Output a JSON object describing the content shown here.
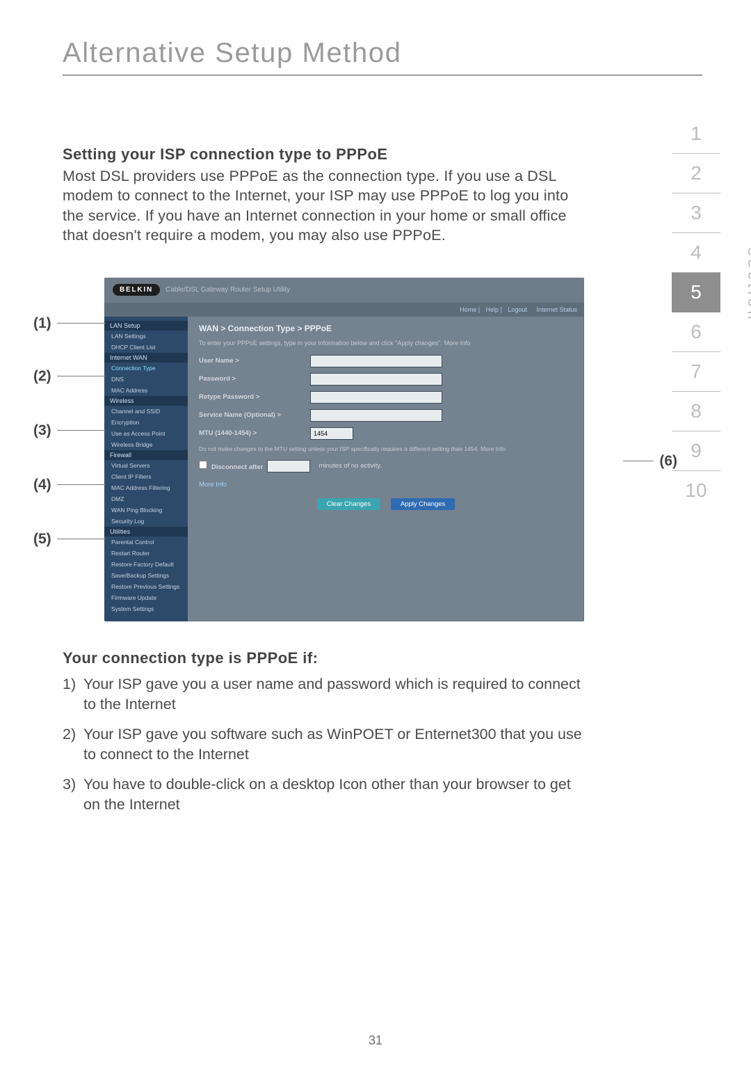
{
  "page_title": "Alternative Setup Method",
  "heading": "Setting your ISP connection type to PPPoE",
  "intro": "Most DSL providers use PPPoE as the connection type. If you use a DSL modem to connect to the Internet, your ISP may use PPPoE to log you into the service. If you have an Internet connection in your home or small office that doesn't require a modem, you may also use PPPoE.",
  "callouts": {
    "c1": "(1)",
    "c2": "(2)",
    "c3": "(3)",
    "c4": "(4)",
    "c5": "(5)",
    "c6": "(6)"
  },
  "section_nav": {
    "label": "section",
    "items": [
      "1",
      "2",
      "3",
      "4",
      "5",
      "6",
      "7",
      "8",
      "9",
      "10"
    ],
    "active": "5"
  },
  "router": {
    "brand": "BELKIN",
    "top_title": "Cable/DSL Gateway Router Setup Utility",
    "sub_links": [
      "Home",
      "Help",
      "Logout",
      "Internet Status"
    ],
    "breadcrumb": "WAN > Connection Type > PPPoE",
    "instructions": "To enter your PPPoE settings, type in your information below and click \"Apply changes\". More Info",
    "fields": {
      "user": "User Name >",
      "pass": "Password >",
      "retype": "Retype Password >",
      "service": "Service Name (Optional) >",
      "mtu": "MTU (1440-1454) >",
      "mtu_value": "1454",
      "mtu_note": "Do not make changes to the MTU setting unless your ISP specifically requires a different setting than 1454. More Info",
      "disconnect": "Disconnect after",
      "disconnect_after": "minutes of no activity.",
      "more": "More Info"
    },
    "buttons": {
      "clear": "Clear Changes",
      "apply": "Apply Changes"
    },
    "sidebar": {
      "g1": "LAN Setup",
      "g1_items": [
        "LAN Settings",
        "DHCP Client List"
      ],
      "g2": "Internet WAN",
      "g2_items": [
        "Connection Type",
        "DNS",
        "MAC Address"
      ],
      "g3": "Wireless",
      "g3_items": [
        "Channel and SSID",
        "Encryption",
        "Use as Access Point",
        "Wireless Bridge"
      ],
      "g4": "Firewall",
      "g4_items": [
        "Virtual Servers",
        "Client IP Filters",
        "MAC Address Filtering",
        "DMZ",
        "WAN Ping Blocking",
        "Security Log"
      ],
      "g5": "Utilities",
      "g5_items": [
        "Parental Control",
        "Restart Router",
        "Restore Factory Default",
        "Save/Backup Settings",
        "Restore Previous Settings",
        "Firmware Update",
        "System Settings"
      ]
    }
  },
  "sub_heading": "Your connection type is PPPoE if:",
  "rules": [
    {
      "n": "1)",
      "t": "Your ISP gave you a user name and password which is required to connect to the Internet"
    },
    {
      "n": "2)",
      "t": "Your ISP gave you software such as WinPOET or Enternet300 that you use to connect to the Internet"
    },
    {
      "n": "3)",
      "t": "You have to double-click on a desktop Icon other than your browser to get on the Internet"
    }
  ],
  "page_number": "31"
}
